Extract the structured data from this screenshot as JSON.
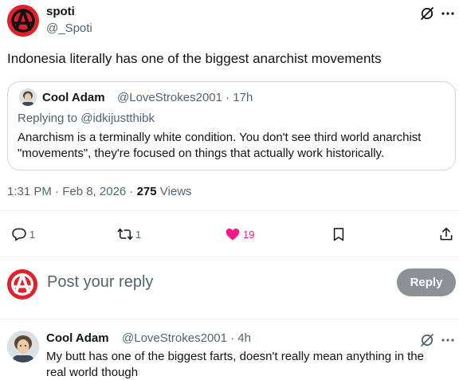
{
  "post": {
    "author_name": "spoti",
    "author_handle": "@_Spoti",
    "text": "Indonesia literally has one of the biggest anarchist movements",
    "timestamp": "1:31 PM · Feb 8, 2026 · ",
    "views_count": "275",
    "views_label": " Views"
  },
  "quoted": {
    "author_name": "Cool Adam",
    "handle_time": "@LoveStrokes2001 · 17h",
    "replying_prefix": "Replying to ",
    "replying_to": "@idkijustthibk",
    "text": "Anarchism is a terminally white condition. You don't see third world anarchist \"movements\", they're focused on things that actually work historically."
  },
  "actions": {
    "replies": "1",
    "reposts": "1",
    "likes": "19",
    "like_color": "#f91880"
  },
  "composer": {
    "placeholder": "Post your reply",
    "button_label": "Reply"
  },
  "reply": {
    "author_name": "Cool Adam",
    "handle_time": "@LoveStrokes2001 · 4h",
    "text": "My butt has one of the biggest farts, doesn't really mean anything in the real world though"
  },
  "icons": {
    "grok": "grok-icon",
    "more": "more-icon",
    "reply": "reply-icon",
    "repost": "repost-icon",
    "like": "heart-icon",
    "bookmark": "bookmark-icon",
    "share": "share-icon"
  },
  "colors": {
    "brand_avatar": "#e0202a",
    "secondary_text": "#536471",
    "reply_button": "#8b9196"
  }
}
